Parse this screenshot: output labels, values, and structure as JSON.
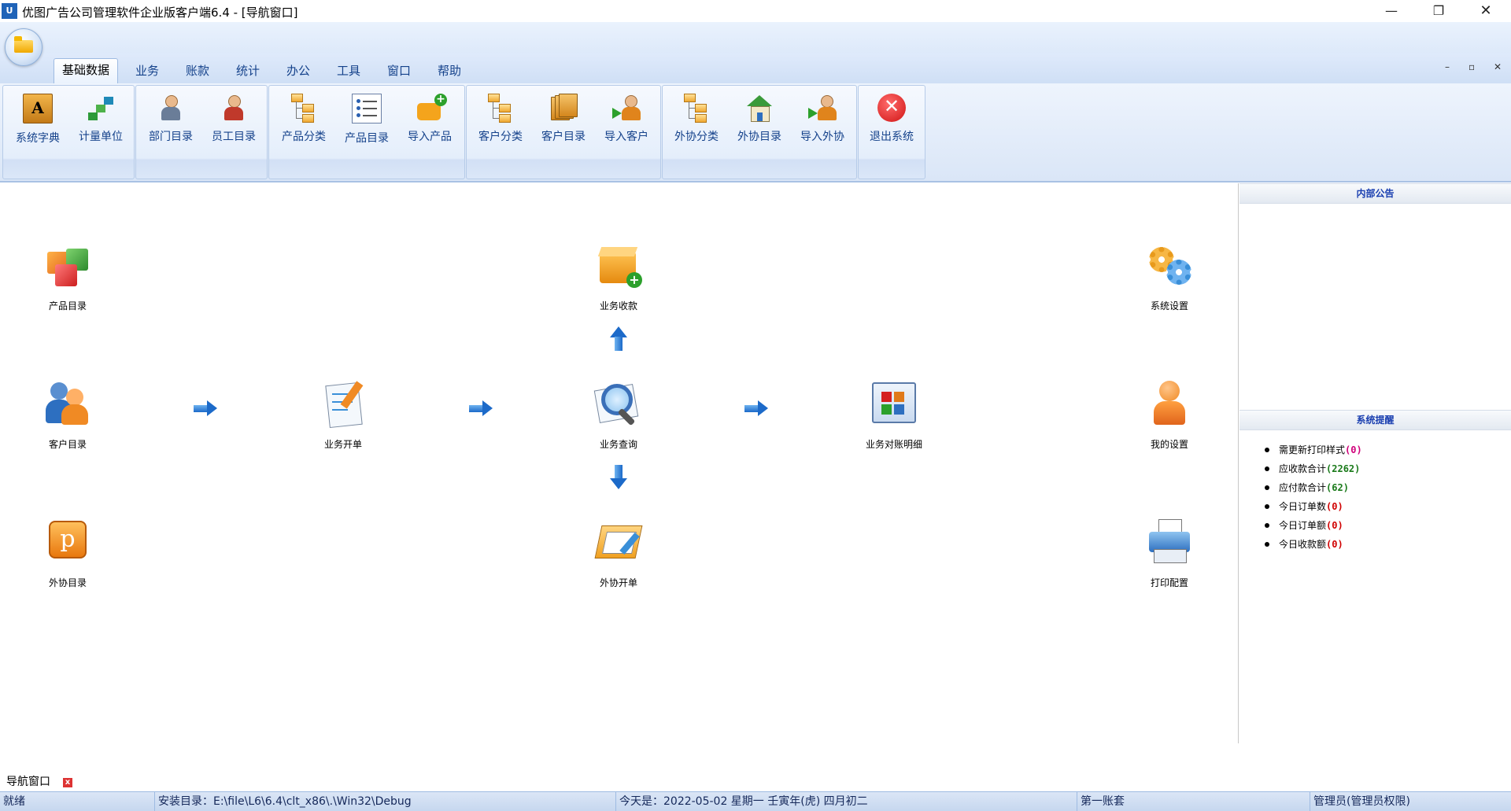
{
  "window": {
    "app_icon": "U",
    "title": "优图广告公司管理软件企业版客户端6.4 - [导航窗口]",
    "minimize": "—",
    "maximize": "❐",
    "close": "✕"
  },
  "tabs": [
    {
      "label": "基础数据",
      "active": true
    },
    {
      "label": "业务"
    },
    {
      "label": "账款"
    },
    {
      "label": "统计"
    },
    {
      "label": "办公"
    },
    {
      "label": "工具"
    },
    {
      "label": "窗口"
    },
    {
      "label": "帮助"
    }
  ],
  "mdi_controls": {
    "minimize": "–",
    "restore": "▫",
    "close": "✕"
  },
  "ribbon": {
    "buttons": [
      {
        "label": "系统字典",
        "icon": "dictionary-book-icon"
      },
      {
        "label": "计量单位",
        "icon": "measure-unit-icon"
      },
      {
        "label": "部门目录",
        "icon": "department-icon"
      },
      {
        "label": "员工目录",
        "icon": "employee-icon"
      },
      {
        "label": "产品分类",
        "icon": "tree-category-icon"
      },
      {
        "label": "产品目录",
        "icon": "list-icon"
      },
      {
        "label": "导入产品",
        "icon": "import-bubble-icon"
      },
      {
        "label": "客户分类",
        "icon": "tree-category-icon"
      },
      {
        "label": "客户目录",
        "icon": "folders-icon"
      },
      {
        "label": "导入客户",
        "icon": "import-person-icon"
      },
      {
        "label": "外协分类",
        "icon": "tree-category-icon"
      },
      {
        "label": "外协目录",
        "icon": "house-icon"
      },
      {
        "label": "导入外协",
        "icon": "import-person-icon"
      },
      {
        "label": "退出系统",
        "icon": "exit-icon"
      }
    ],
    "book_glyph": "A",
    "exit_glyph": "✕",
    "plus_glyph": "+"
  },
  "nav": {
    "product_catalog": "产品目录",
    "business_receipt": "业务收款",
    "system_settings": "系统设置",
    "customer_catalog": "客户目录",
    "business_order": "业务开单",
    "business_query": "业务查询",
    "business_statement": "业务对账明细",
    "my_settings": "我的设置",
    "outsource_catalog": "外协目录",
    "outsource_order": "外协开单",
    "print_config": "打印配置",
    "outsource_glyph": "p"
  },
  "side": {
    "notice_title": "内部公告",
    "reminder_title": "系统提醒",
    "reminders": [
      {
        "label": "需更新打印样式",
        "count": "(0)",
        "color": "#d0007a"
      },
      {
        "label": "应收款合计",
        "count": "(2262)",
        "color": "#1a7a1a"
      },
      {
        "label": "应付款合计",
        "count": "(62)",
        "color": "#1a7a1a"
      },
      {
        "label": "今日订单数",
        "count": "(0)",
        "color": "#d00000"
      },
      {
        "label": "今日订单额",
        "count": "(0)",
        "color": "#d00000"
      },
      {
        "label": "今日收款额",
        "count": "(0)",
        "color": "#d00000"
      }
    ]
  },
  "doc_tab": {
    "label": "导航窗口",
    "close": "x"
  },
  "status": {
    "ready": "就绪",
    "install_dir": "安装目录：E:\\file\\L6\\6.4\\clt_x86\\.\\Win32\\Debug",
    "today": "今天是：2022-05-02 星期一 壬寅年(虎) 四月初二",
    "account": "第一账套",
    "user": "管理员(管理员权限)"
  }
}
